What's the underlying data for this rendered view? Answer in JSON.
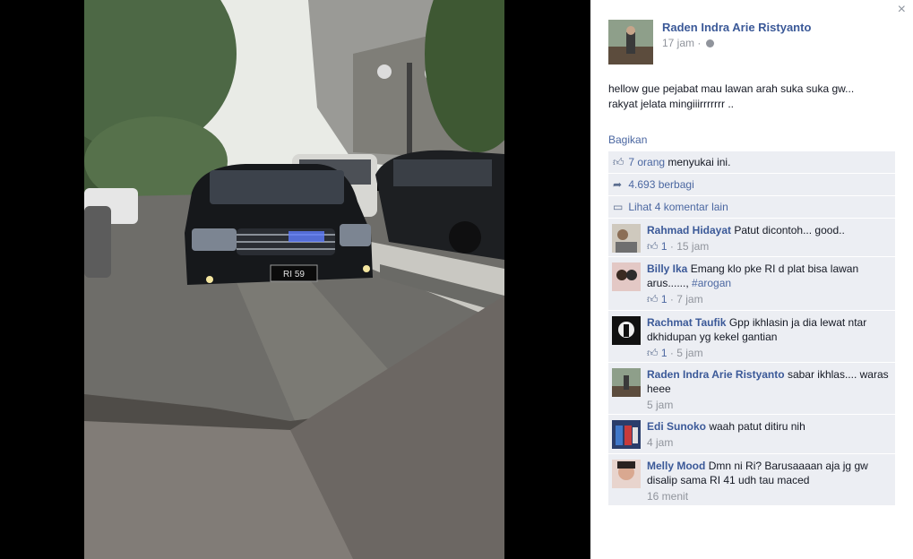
{
  "post": {
    "author": "Raden Indra Arie Ristyanto",
    "time": "17 jam",
    "separator": "·",
    "text_line1": "hellow gue pejabat mau lawan arah suka suka gw...",
    "text_line2": "rakyat jelata mingiiirrrrrrr ..",
    "share_label": "Bagikan"
  },
  "close_symbol": "×",
  "ufi": {
    "likes_count": "7 orang",
    "likes_suffix": " menyukai ini.",
    "shares": "4.693 berbagi",
    "more_comments": "Lihat 4 komentar lain"
  },
  "comments": [
    {
      "name": "Rahmad Hidayat",
      "text": "Patut dicontoh... good..",
      "likes": "1",
      "time": "15 jam"
    },
    {
      "name": "Billy Ika",
      "text": "Emang klo pke RI d plat bisa lawan arus......, ",
      "hashtag": "#arogan",
      "likes": "1",
      "time": "7 jam"
    },
    {
      "name": "Rachmat Taufik",
      "text": "Gpp ikhlasin ja dia lewat ntar dkhidupan yg kekel gantian",
      "likes": "1",
      "time": "5 jam"
    },
    {
      "name": "Raden Indra Arie Ristyanto",
      "text": "sabar ikhlas.... waras heee",
      "time": "5 jam"
    },
    {
      "name": "Edi Sunoko",
      "text": "waah patut ditiru nih",
      "time": "4 jam"
    },
    {
      "name": "Melly Mood",
      "text": "Dmn ni Ri? Barusaaaan aja jg gw disalip sama RI 41 udh tau maced",
      "time": "16 menit"
    }
  ],
  "photo": {
    "plate": "RI 59"
  },
  "icons": {
    "like": "thumbs-up-icon",
    "share": "share-arrow-icon",
    "comment": "speech-bubble-icon",
    "globe": "globe-icon",
    "close": "close-icon"
  },
  "colors": {
    "link": "#3b5998",
    "ufi_bg": "#eceef3",
    "meta": "#90949c"
  }
}
